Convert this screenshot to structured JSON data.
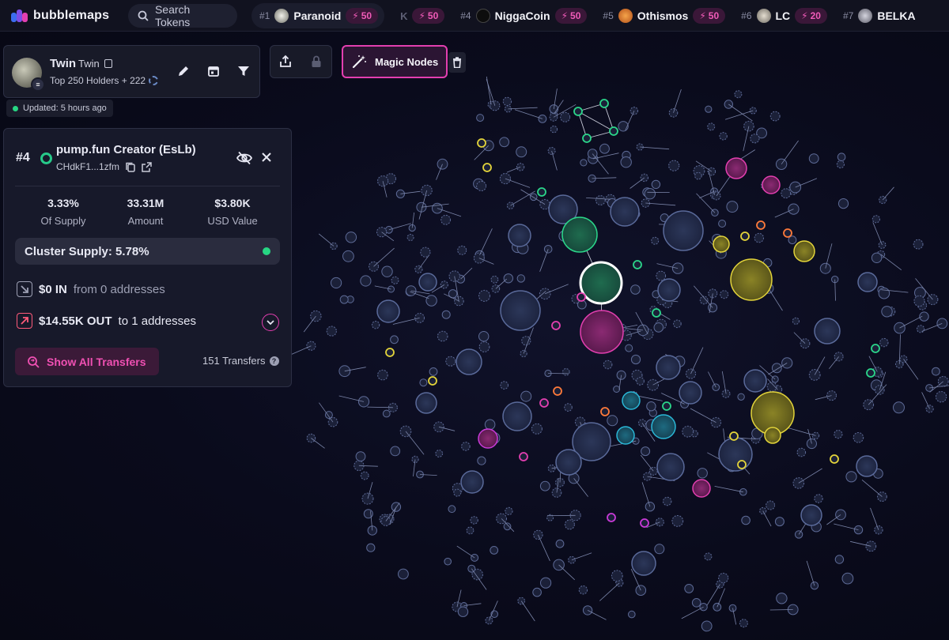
{
  "app": {
    "name": "bubblemaps"
  },
  "search": {
    "label": "Search Tokens"
  },
  "trending": [
    {
      "rank": "#1",
      "name": "Paranoid",
      "boost": "50",
      "avatar_color": "#d8d8d0"
    },
    {
      "rank": "",
      "name": "",
      "ghost": "K",
      "boost": "50",
      "avatar_color": ""
    },
    {
      "rank": "#4",
      "name": "NiggaCoin",
      "boost": "50",
      "avatar_color": "#111111"
    },
    {
      "rank": "#5",
      "name": "Othismos",
      "boost": "50",
      "avatar_color": "#e07a2a"
    },
    {
      "rank": "#6",
      "name": "LC",
      "boost": "20",
      "avatar_color": "#b9b2a5"
    },
    {
      "rank": "#7",
      "name": "BELKA",
      "boost": "",
      "avatar_color": "#a8a8b4"
    }
  ],
  "token": {
    "name": "Twin",
    "symbol": "Twin",
    "holders": "Top 250 Holders + 222",
    "updated": "Updated: 5 hours ago",
    "chain_icon": "solana-icon"
  },
  "actions": {
    "magic_label": "Magic Nodes"
  },
  "wallet": {
    "rank": "#4",
    "name": "pump.fun Creator (EsLb)",
    "address": "CHdkF1...1zfm",
    "stats": [
      {
        "value": "3.33%",
        "label": "Of Supply"
      },
      {
        "value": "33.31M",
        "label": "Amount"
      },
      {
        "value": "$3.80K",
        "label": "USD Value"
      }
    ],
    "cluster": "Cluster Supply: 5.78%",
    "in_amount": "$0 IN",
    "in_sub": "from 0 addresses",
    "out_amount": "$14.55K OUT",
    "out_sub": "to 1 addresses",
    "show_transfers": "Show All Transfers",
    "transfers_count": "151 Transfers"
  },
  "colors": {
    "accent": "#e33fb0",
    "green": "#27d683",
    "bubble_default": "#2a3354",
    "bubble_stroke": "#5a6a9a"
  }
}
